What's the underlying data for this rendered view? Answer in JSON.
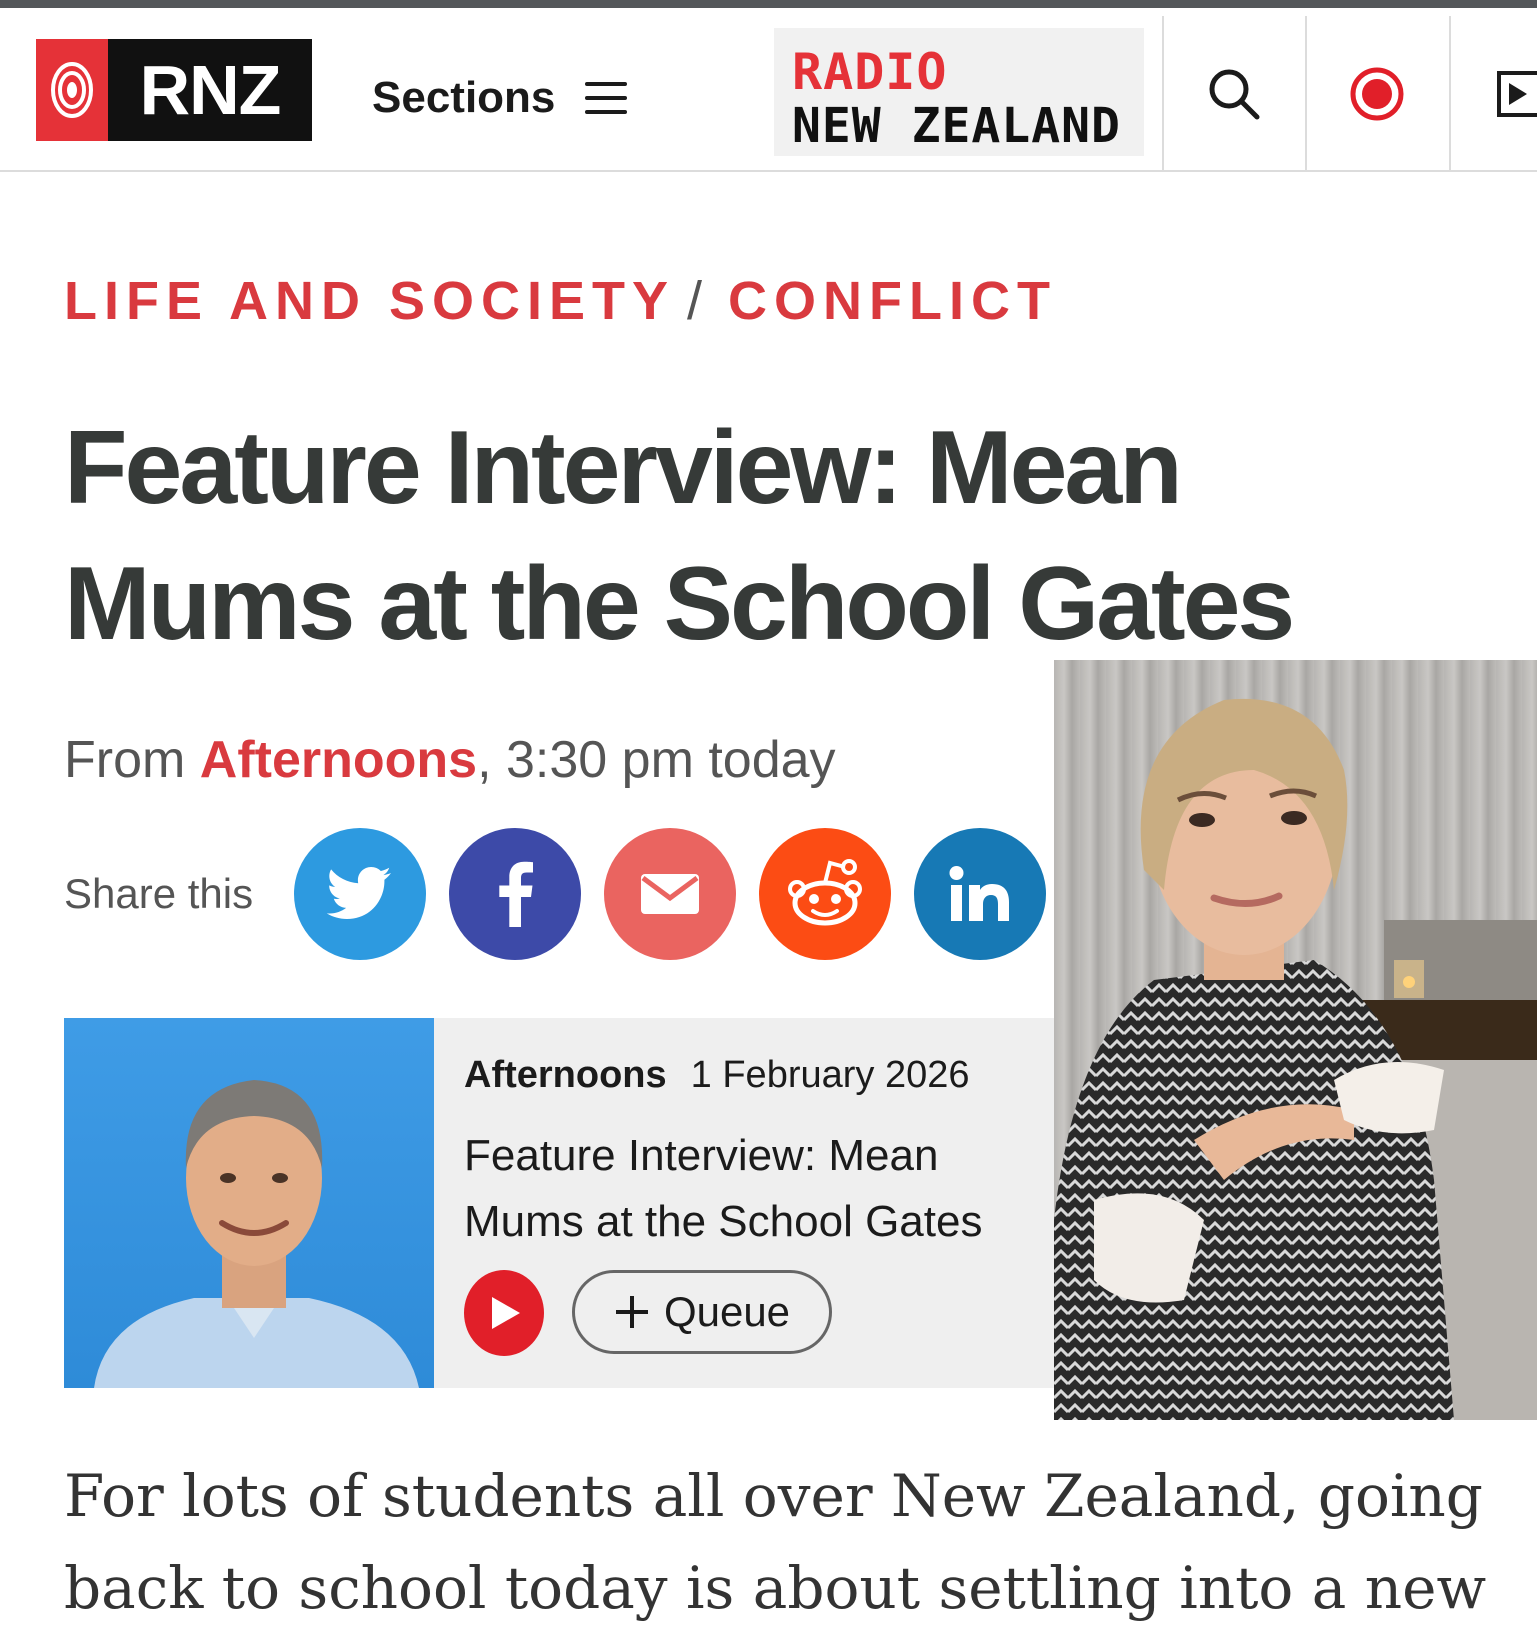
{
  "header": {
    "logo_text": "RNZ",
    "sections_label": "Sections",
    "brand_line1": "RADIO",
    "brand_line2": "NEW ZEALAND",
    "icons": [
      "search-icon",
      "live-record-icon",
      "play-icon"
    ]
  },
  "breadcrumb": {
    "first": "LIFE AND SOCIETY",
    "separator": "/",
    "second": "CONFLICT"
  },
  "article": {
    "headline": "Feature Interview: Mean Mums at the School Gates",
    "meta_from": "From",
    "meta_programme": "Afternoons",
    "meta_time": ", 3:30 pm today",
    "share_label": "Share this",
    "lead": "For lots of students all over New Zealand, going back to school today is about settling into a new"
  },
  "share": {
    "buttons": [
      {
        "name": "twitter",
        "color": "#2d9ae0"
      },
      {
        "name": "facebook",
        "color": "#3d4aa8"
      },
      {
        "name": "email",
        "color": "#ea6460"
      },
      {
        "name": "reddit",
        "color": "#fc4c14"
      },
      {
        "name": "linkedin",
        "color": "#1779b5"
      }
    ]
  },
  "audio": {
    "programme": "Afternoons",
    "date": "1 February 2026",
    "title": "Feature Interview: Mean Mums at the School Gates",
    "queue_label": "Queue"
  },
  "colors": {
    "accent_red": "#e53238",
    "crumb_red": "#d93a3f",
    "headline": "#363a38"
  }
}
